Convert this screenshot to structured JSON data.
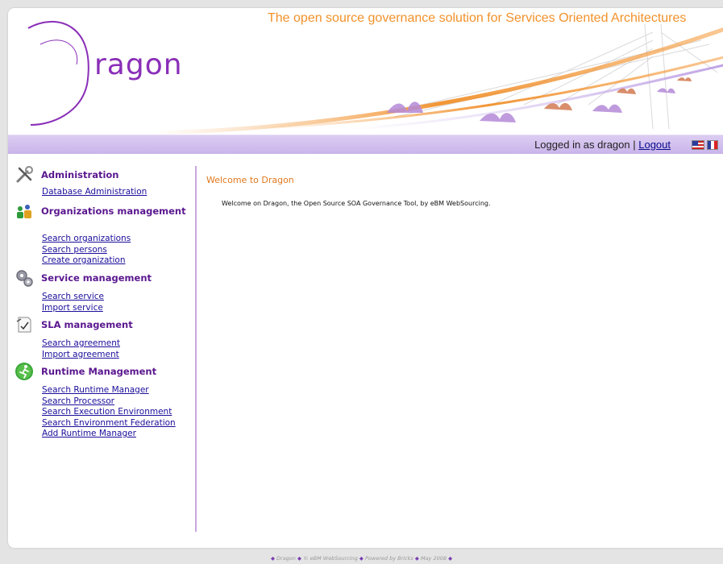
{
  "header": {
    "tagline": "The open source  governance solution for Services Oriented Architectures",
    "logo": {
      "first": "ragon"
    }
  },
  "userbar": {
    "logged_in_text": "Logged in as dragon | ",
    "logout_label": "Logout",
    "flags": [
      "english-flag-icon",
      "french-flag-icon"
    ]
  },
  "sidebar": {
    "sections": [
      {
        "icon": "tools-icon",
        "title": "Administration",
        "links": [
          "Database Administration"
        ]
      },
      {
        "icon": "organizations-icon",
        "title": "Organizations management",
        "links": [
          "Search organizations",
          "Search persons",
          "Create organization"
        ]
      },
      {
        "icon": "gears-icon",
        "title": "Service management",
        "links": [
          "Search service",
          "Import service"
        ]
      },
      {
        "icon": "agreement-icon",
        "title": "SLA management",
        "links": [
          "Search agreement",
          "Import agreement"
        ]
      },
      {
        "icon": "runtime-icon",
        "title": "Runtime Management",
        "links": [
          "Search Runtime Manager",
          "Search Processor",
          "Search Execution Environment",
          "Search Environment Federation",
          "Add Runtime Manager"
        ]
      }
    ]
  },
  "content": {
    "title": "Welcome to Dragon",
    "text": "Welcome on Dragon, the Open Source SOA Governance Tool, by eBM WebSourcing."
  },
  "footer": {
    "parts": [
      "Dragon",
      "© eBM WebSourcing",
      "Powered by Bricks",
      "May 2008"
    ]
  },
  "colors": {
    "accent_purple": "#5a178f",
    "accent_orange": "#f2912a",
    "link_blue": "#1a0e9a"
  }
}
